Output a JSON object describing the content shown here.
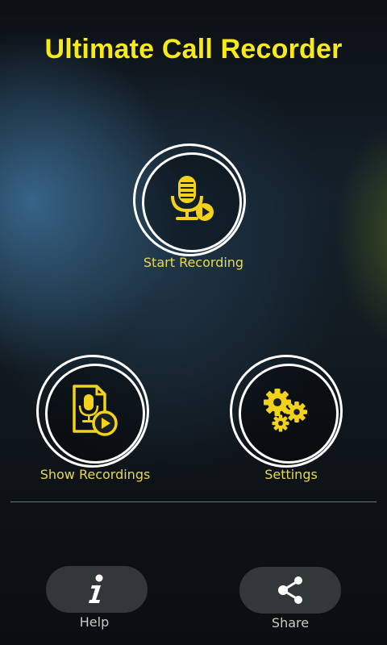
{
  "app": {
    "title": "Ultimate Call Recorder"
  },
  "main": {
    "start_recording": {
      "label": "Start Recording",
      "icon": "microphone-play-icon"
    },
    "show_recordings": {
      "label": "Show Recordings",
      "icon": "recording-file-play-icon"
    },
    "settings": {
      "label": "Settings",
      "icon": "gears-icon"
    }
  },
  "footer": {
    "help": {
      "label": "Help",
      "icon": "info-icon"
    },
    "share": {
      "label": "Share",
      "icon": "share-icon"
    }
  },
  "colors": {
    "accent": "#f8ea16",
    "icon_yellow": "#f2d21b",
    "label_gold": "#e6d94f",
    "ring_white": "#ffffff"
  }
}
